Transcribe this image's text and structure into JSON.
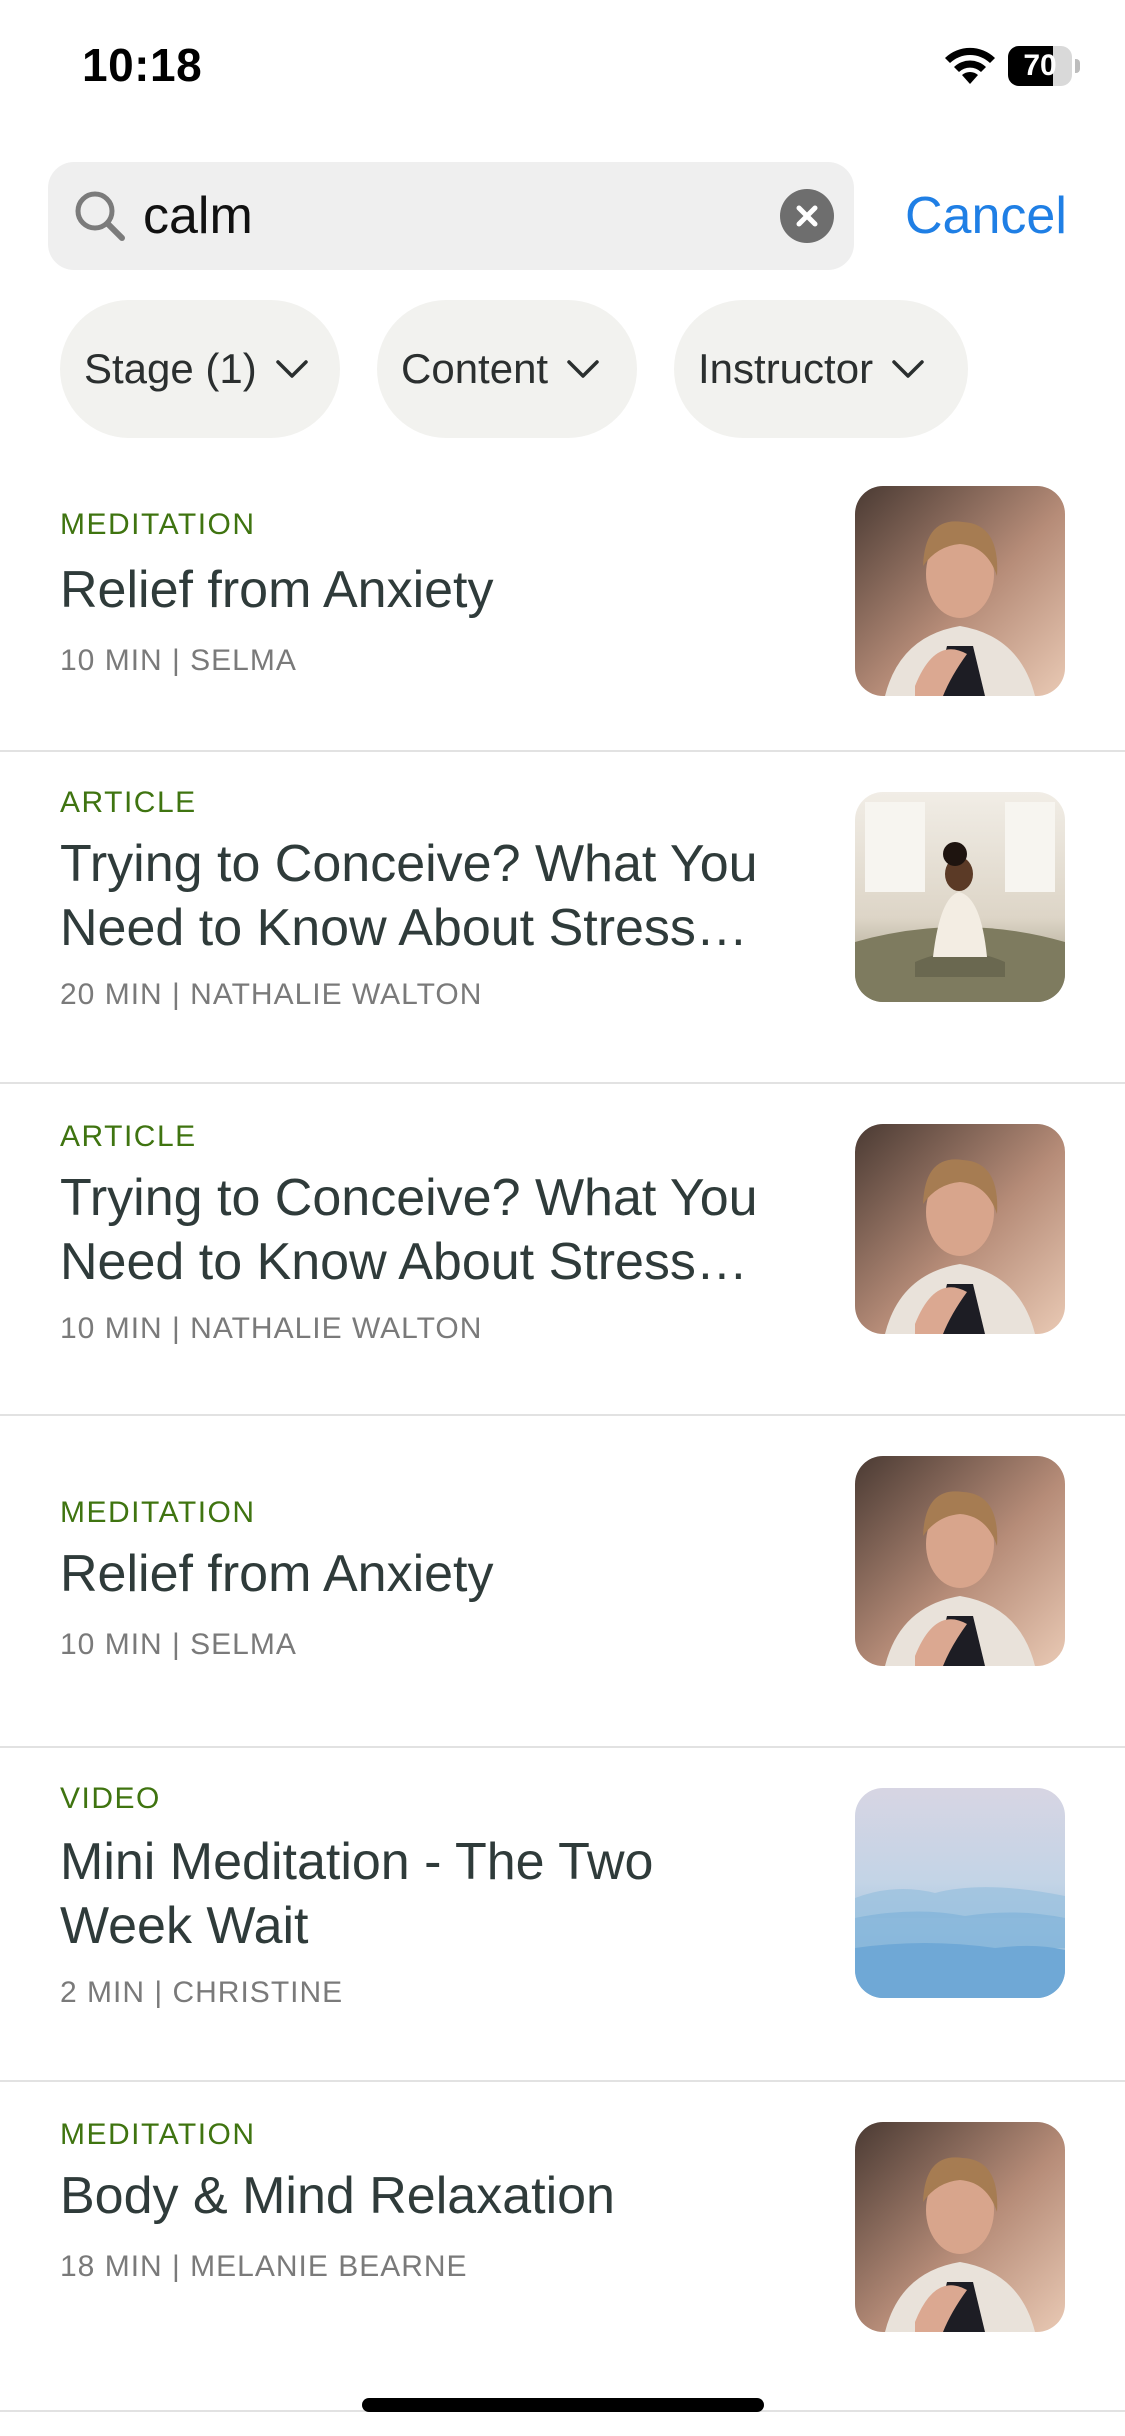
{
  "status_bar": {
    "time": "10:18",
    "battery": "70",
    "battery_level": 0.7
  },
  "search": {
    "query": "calm",
    "cancel_label": "Cancel"
  },
  "filters": [
    {
      "label": "Stage (1)"
    },
    {
      "label": "Content"
    },
    {
      "label": "Instructor"
    }
  ],
  "results": [
    {
      "category": "MEDITATION",
      "title_lines": [
        "Relief from Anxiety"
      ],
      "meta": "10 MIN | SELMA",
      "thumb": "woman-hand-on-chest"
    },
    {
      "category": "ARTICLE",
      "title_lines": [
        "Trying to Conceive? What You",
        "Need to Know About Stress…"
      ],
      "meta": "20 MIN | NATHALIE WALTON",
      "thumb": "woman-sitting-on-bed"
    },
    {
      "category": "ARTICLE",
      "title_lines": [
        "Trying to Conceive? What You",
        "Need to Know About Stress…"
      ],
      "meta": "10 MIN | NATHALIE WALTON",
      "thumb": "woman-hand-on-chest"
    },
    {
      "category": "MEDITATION",
      "title_lines": [
        "Relief from Anxiety"
      ],
      "meta": "10 MIN | SELMA",
      "thumb": "woman-hand-on-chest"
    },
    {
      "category": "VIDEO",
      "title_lines": [
        "Mini Meditation - The Two",
        "Week Wait"
      ],
      "meta": "2 MIN | CHRISTINE",
      "thumb": "misty-mountains"
    },
    {
      "category": "MEDITATION",
      "title_lines": [
        "Body & Mind Relaxation"
      ],
      "meta": "18 MIN | MELANIE BEARNE",
      "thumb": "woman-hand-on-chest"
    }
  ],
  "colors": {
    "category": "#3f7410",
    "accent": "#1f7fe5"
  }
}
